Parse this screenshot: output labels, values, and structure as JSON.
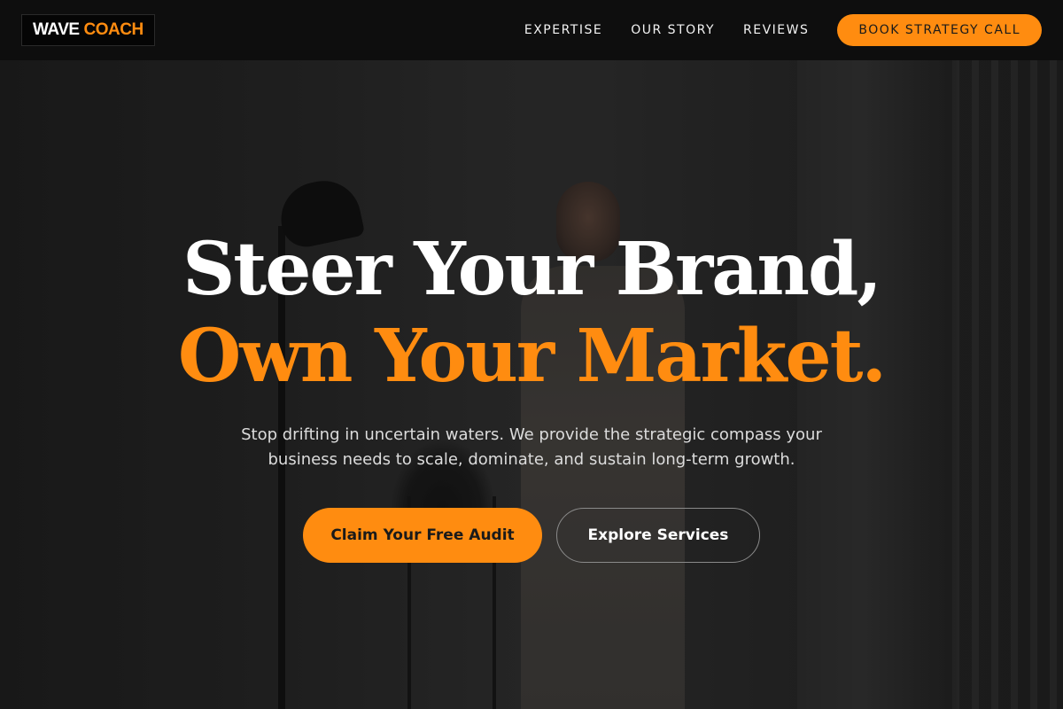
{
  "brand": {
    "word1": "WAVE",
    "word2": "COACH",
    "accent_color": "#ff8c10"
  },
  "nav": {
    "links": [
      "EXPERTISE",
      "OUR STORY",
      "REVIEWS"
    ],
    "cta_label": "BOOK STRATEGY CALL"
  },
  "hero": {
    "headline_line1": "Steer Your Brand,",
    "headline_line2": "Own Your Market.",
    "subtext": "Stop drifting in uncertain waters. We provide the strategic compass your business needs to scale, dominate, and sustain long-term growth.",
    "primary_cta": "Claim Your Free Audit",
    "secondary_cta": "Explore Services"
  }
}
